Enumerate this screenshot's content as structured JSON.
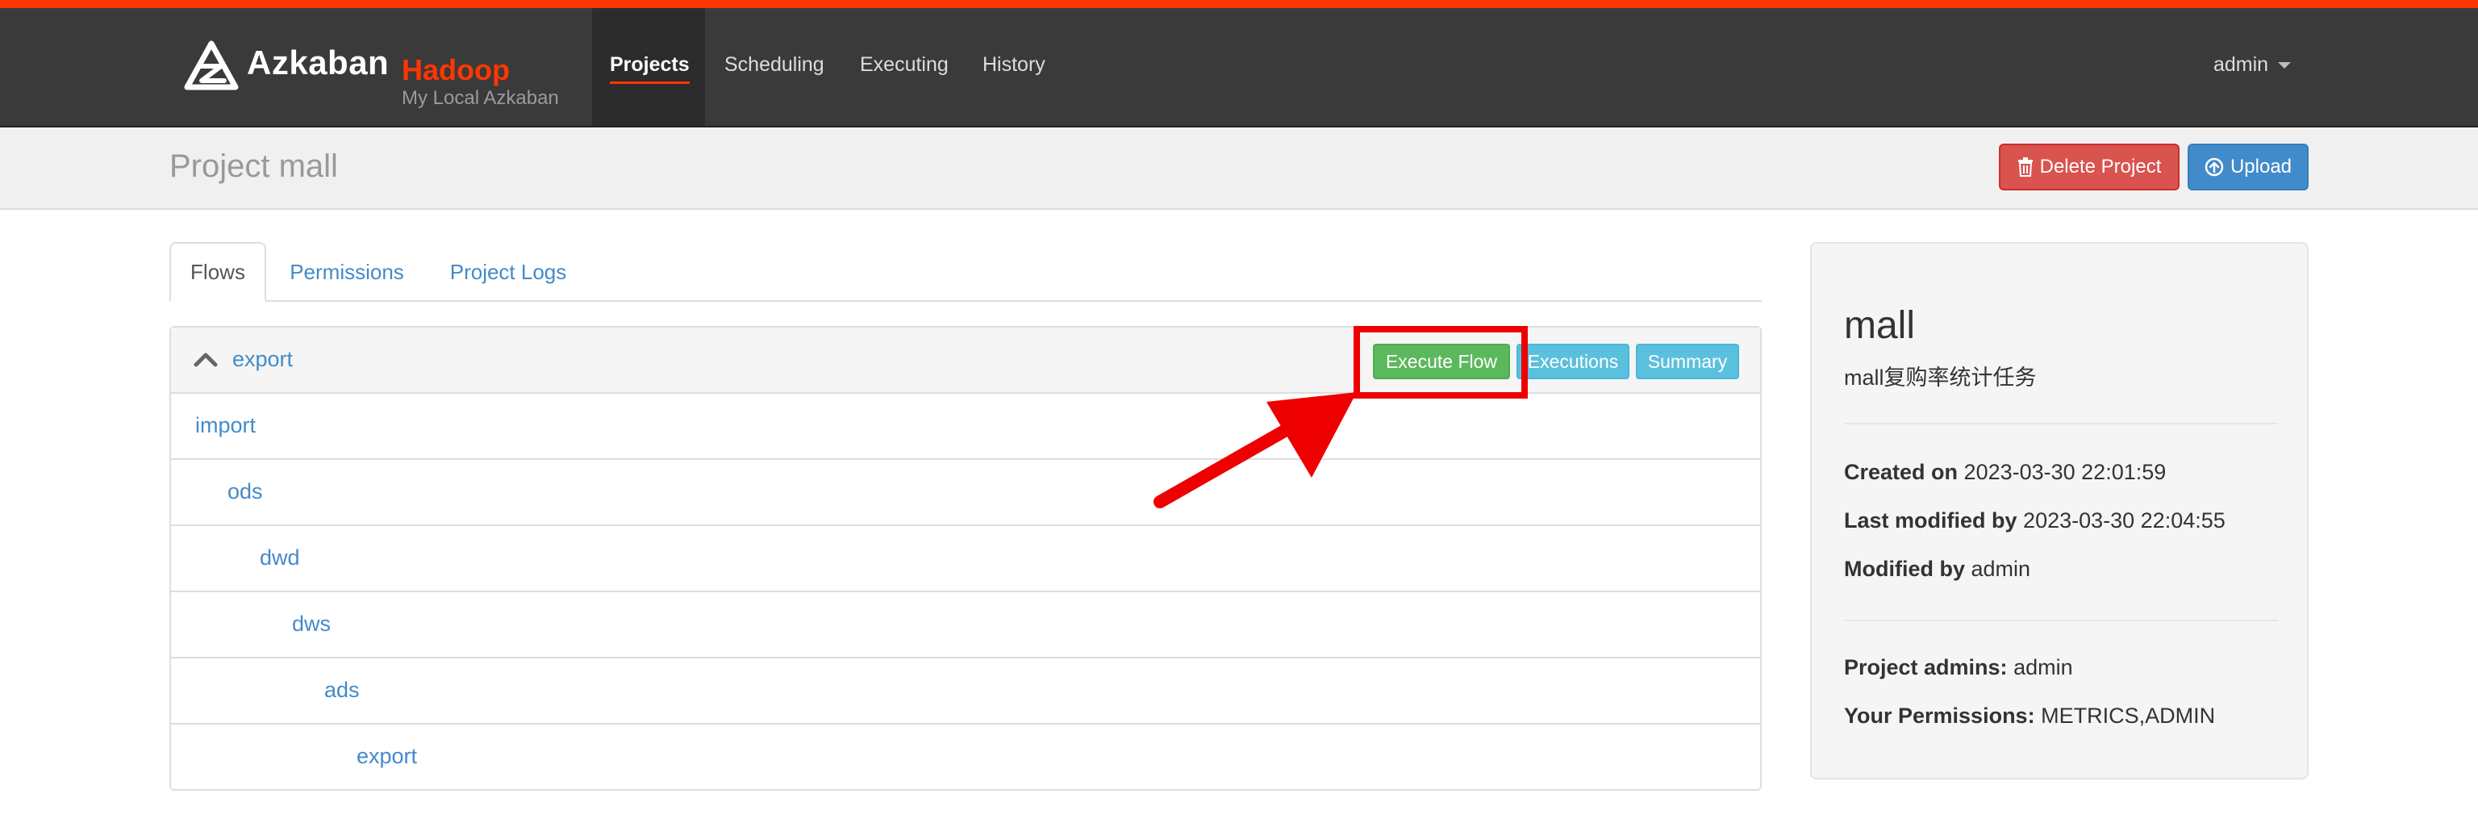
{
  "colors": {
    "accent": "#ff3601",
    "navbar": "#3a3a3a",
    "link": "#428bca",
    "danger": "#d9534f",
    "primary": "#428bca",
    "success": "#5cb85c",
    "info": "#5bc0de",
    "annotation": "#ee0000"
  },
  "brand": {
    "name": "Azkaban",
    "env": "Hadoop",
    "subtitle": "My Local Azkaban",
    "icon": "azkaban-logo-icon"
  },
  "nav": {
    "items": [
      {
        "label": "Projects",
        "active": true
      },
      {
        "label": "Scheduling",
        "active": false
      },
      {
        "label": "Executing",
        "active": false
      },
      {
        "label": "History",
        "active": false
      }
    ],
    "user": "admin"
  },
  "header": {
    "title": "Project mall",
    "delete_label": "Delete Project",
    "delete_icon": "trash-icon",
    "upload_label": "Upload",
    "upload_icon": "upload-icon"
  },
  "tabs": [
    {
      "label": "Flows",
      "active": true
    },
    {
      "label": "Permissions",
      "active": false
    },
    {
      "label": "Project Logs",
      "active": false
    }
  ],
  "flow": {
    "name": "export",
    "toggle_icon": "chevron-up-icon",
    "execute_label": "Execute Flow",
    "executions_label": "Executions",
    "summary_label": "Summary",
    "jobs": [
      {
        "name": "import",
        "depth": 0
      },
      {
        "name": "ods",
        "depth": 1
      },
      {
        "name": "dwd",
        "depth": 2
      },
      {
        "name": "dws",
        "depth": 3
      },
      {
        "name": "ads",
        "depth": 4
      },
      {
        "name": "export",
        "depth": 5
      }
    ]
  },
  "project_info": {
    "name": "mall",
    "description": "mall复购率统计任务",
    "created_label": "Created on",
    "created_value": "2023-03-30 22:01:59",
    "modified_label": "Last modified by",
    "modified_value": "2023-03-30 22:04:55",
    "modified_by_label": "Modified by",
    "modified_by_value": "admin",
    "admins_label": "Project admins:",
    "admins_value": "admin",
    "permissions_label": "Your Permissions:",
    "permissions_value": "METRICS,ADMIN"
  },
  "annotation": {
    "highlight": "highlight-box",
    "arrow": "arrow-icon"
  }
}
